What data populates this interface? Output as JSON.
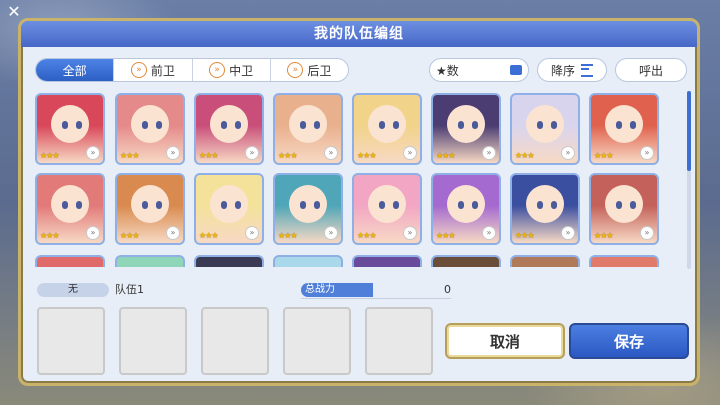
{
  "dialog": {
    "title": "我的队伍编组"
  },
  "filters": {
    "tabs": [
      {
        "label": "全部",
        "active": true
      },
      {
        "label": "前卫",
        "active": false
      },
      {
        "label": "中卫",
        "active": false
      },
      {
        "label": "后卫",
        "active": false
      }
    ]
  },
  "controls": {
    "sort_label": "★数",
    "order_label": "降序",
    "call_label": "呼出"
  },
  "roster": {
    "rows": [
      [
        {
          "stars": "★★★",
          "hair": "#d9485a"
        },
        {
          "stars": "★★★",
          "hair": "#e58a8a"
        },
        {
          "stars": "★★★",
          "hair": "#c94f7a"
        },
        {
          "stars": "★★★",
          "hair": "#e9b08e"
        },
        {
          "stars": "★★★",
          "hair": "#f1d38a"
        },
        {
          "stars": "★★★",
          "hair": "#4b3d72"
        },
        {
          "stars": "★★★",
          "hair": "#d9d4ee"
        },
        {
          "stars": "★★★",
          "hair": "#e0624e"
        }
      ],
      [
        {
          "stars": "★★★",
          "hair": "#e27a7a"
        },
        {
          "stars": "★★★",
          "hair": "#d98b4f"
        },
        {
          "stars": "★★★",
          "hair": "#f4e29a"
        },
        {
          "stars": "★★★",
          "hair": "#4fa6b8"
        },
        {
          "stars": "★★★",
          "hair": "#f2a6c4"
        },
        {
          "stars": "★★★",
          "hair": "#a46ad0"
        },
        {
          "stars": "★★★",
          "hair": "#3b4fa0"
        },
        {
          "stars": "★★★",
          "hair": "#c4615a"
        }
      ],
      [
        {
          "stars": "",
          "hair": "#e06a6a"
        },
        {
          "stars": "",
          "hair": "#8fd6b8"
        },
        {
          "stars": "",
          "hair": "#3a3a55"
        },
        {
          "stars": "",
          "hair": "#a9d8ea"
        },
        {
          "stars": "",
          "hair": "#6a4a9a"
        },
        {
          "stars": "",
          "hair": "#6a4e3a"
        },
        {
          "stars": "",
          "hair": "#b07a5a"
        },
        {
          "stars": "",
          "hair": "#e07a6a"
        }
      ]
    ]
  },
  "party": {
    "none_label": "无",
    "team_name": "队伍1",
    "power_label": "总战力",
    "power_value": "0"
  },
  "actions": {
    "cancel_label": "取消",
    "save_label": "保存"
  }
}
